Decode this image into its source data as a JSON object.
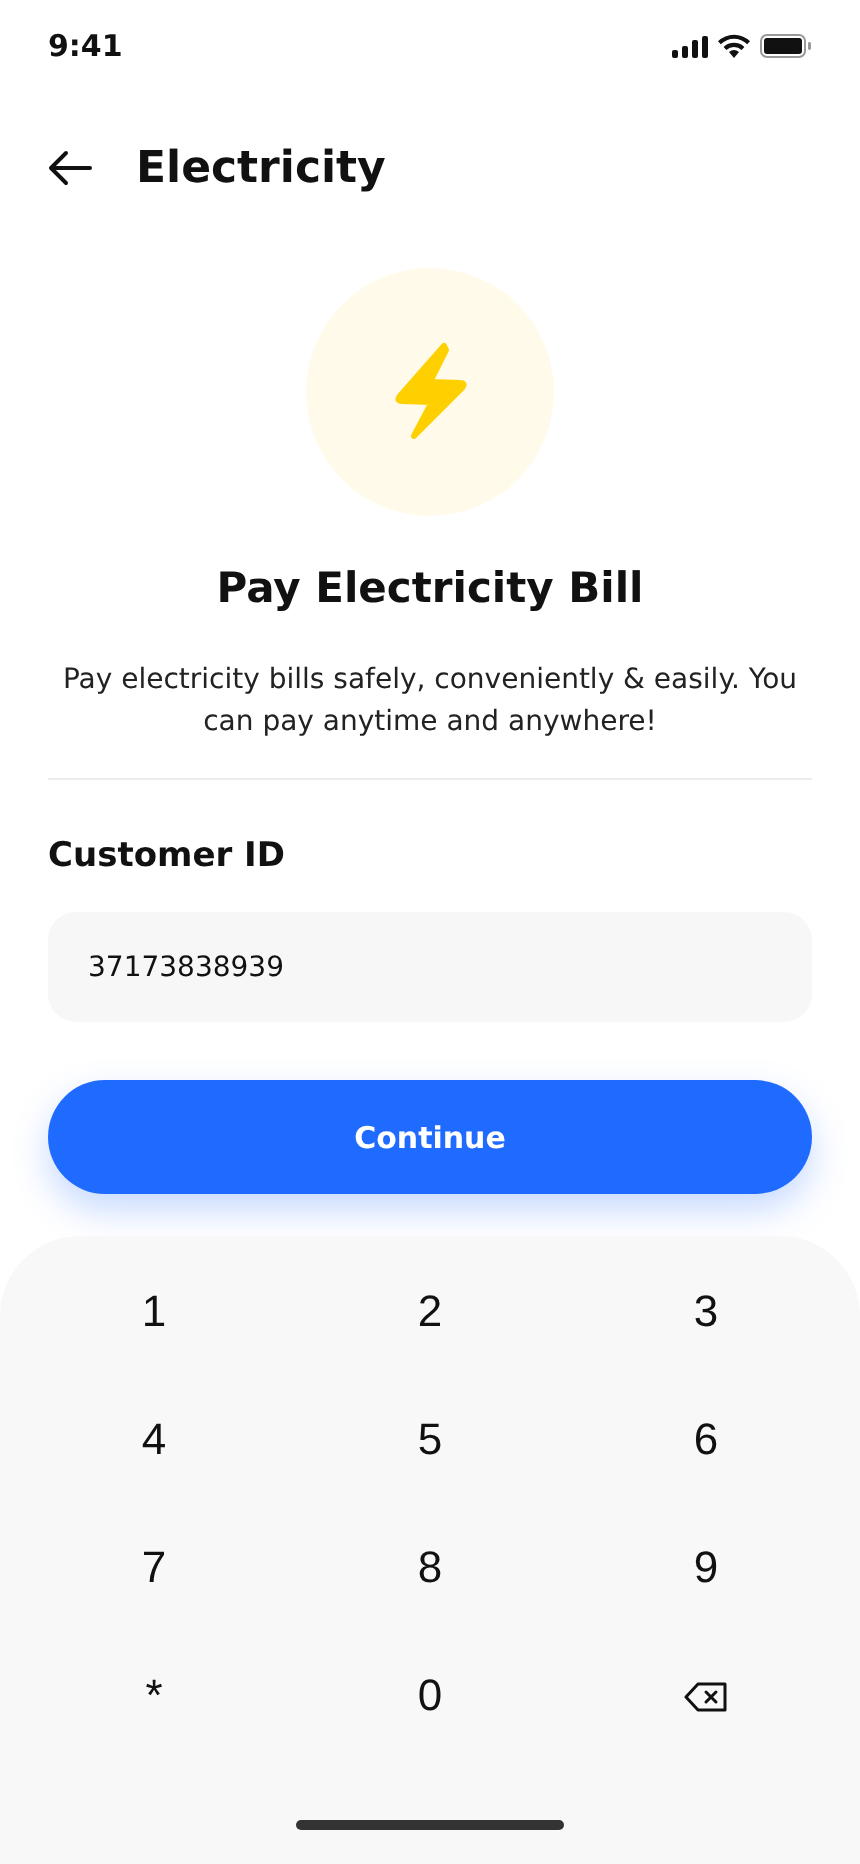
{
  "status_bar": {
    "time": "9:41"
  },
  "header": {
    "title": "Electricity"
  },
  "hero": {
    "title": "Pay Electricity Bill",
    "description": "Pay electricity bills safely, conveniently & easily. You can pay anytime and anywhere!"
  },
  "form": {
    "label": "Customer ID",
    "value": "37173838939"
  },
  "continue_button": {
    "label": "Continue"
  },
  "keypad": {
    "keys": [
      {
        "kind": "digit",
        "label": "1"
      },
      {
        "kind": "digit",
        "label": "2"
      },
      {
        "kind": "digit",
        "label": "3"
      },
      {
        "kind": "digit",
        "label": "4"
      },
      {
        "kind": "digit",
        "label": "5"
      },
      {
        "kind": "digit",
        "label": "6"
      },
      {
        "kind": "digit",
        "label": "7"
      },
      {
        "kind": "digit",
        "label": "8"
      },
      {
        "kind": "digit",
        "label": "9"
      },
      {
        "kind": "digit",
        "label": "*"
      },
      {
        "kind": "digit",
        "label": "0"
      },
      {
        "kind": "backspace"
      }
    ]
  }
}
